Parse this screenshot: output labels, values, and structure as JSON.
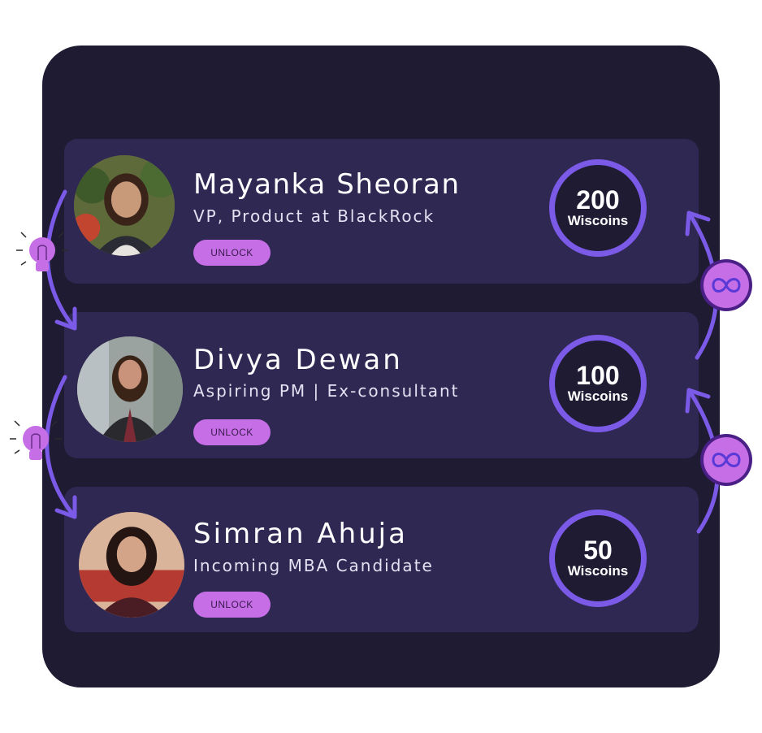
{
  "profiles": [
    {
      "name": "Mayanka Sheoran",
      "role": "VP, Product at BlackRock",
      "unlock_label": "UNLOCK",
      "coins": "200",
      "coin_unit": "Wiscoins"
    },
    {
      "name": "Divya Dewan",
      "role": "Aspiring PM | Ex-consultant",
      "unlock_label": "UNLOCK",
      "coins": "100",
      "coin_unit": "Wiscoins"
    },
    {
      "name": "Simran Ahuja",
      "role": "Incoming MBA Candidate",
      "unlock_label": "UNLOCK",
      "coins": "50",
      "coin_unit": "Wiscoins"
    }
  ],
  "icons": {
    "flow_left": "lightbulb-icon",
    "flow_right": "infinity-icon",
    "arrows": "curved-arrow-icon"
  },
  "colors": {
    "panel": "#1e1b33",
    "card": "#2f2853",
    "accent": "#7a5ae6",
    "button": "#c66ee6"
  }
}
